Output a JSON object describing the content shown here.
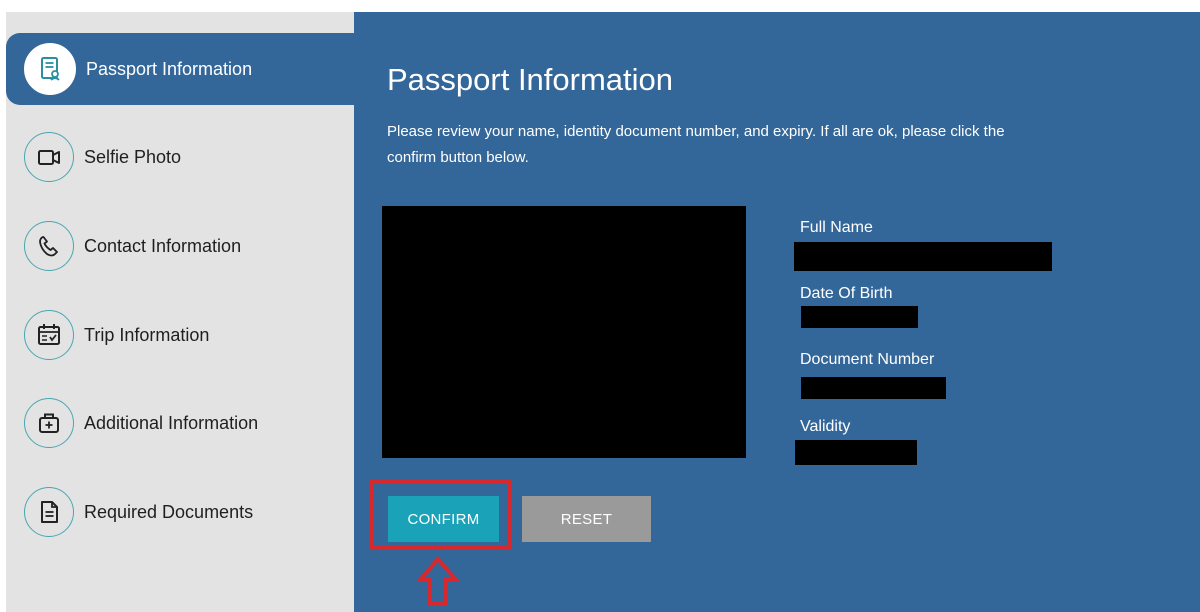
{
  "sidebar": {
    "items": [
      {
        "label": "Passport Information",
        "icon": "passport-document-icon",
        "active": true
      },
      {
        "label": "Selfie Photo",
        "icon": "video-camera-icon",
        "active": false
      },
      {
        "label": "Contact Information",
        "icon": "phone-icon",
        "active": false
      },
      {
        "label": "Trip Information",
        "icon": "calendar-check-icon",
        "active": false
      },
      {
        "label": "Additional Information",
        "icon": "medical-kit-icon",
        "active": false
      },
      {
        "label": "Required Documents",
        "icon": "document-icon",
        "active": false
      }
    ]
  },
  "main": {
    "title": "Passport Information",
    "instructions": "Please review your name, identity document number, and expiry. If all are ok, please click the confirm button below.",
    "fields": {
      "full_name_label": "Full Name",
      "dob_label": "Date Of Birth",
      "doc_number_label": "Document Number",
      "validity_label": "Validity"
    },
    "buttons": {
      "confirm": "CONFIRM",
      "reset": "RESET"
    }
  },
  "colors": {
    "primary": "#336699",
    "sidebar_bg": "#e3e3e3",
    "confirm": "#1aa3b8",
    "reset": "#9a9a9a",
    "highlight": "#d6282d",
    "icon_ring": "#4aa6b3"
  }
}
